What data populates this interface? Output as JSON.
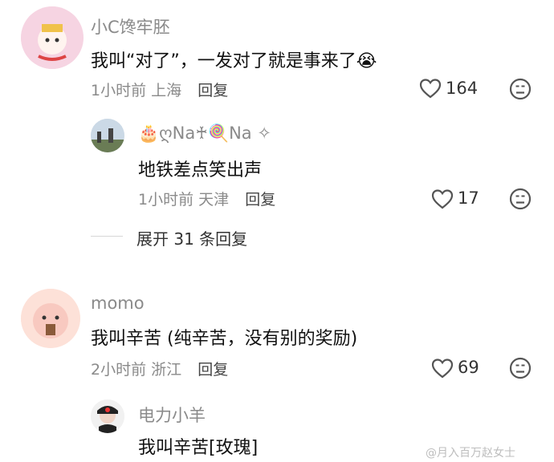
{
  "comments": [
    {
      "user": "小C馋牢胚",
      "text": "我叫“对了”，一发对了就是事来了",
      "emoji": "😭",
      "time": "1小时前",
      "location": "上海",
      "reply_label": "回复",
      "likes": "164"
    },
    {
      "user": "🎂ღNa♰🍭Na ✧",
      "text": "地铁差点笑出声",
      "time": "1小时前",
      "location": "天津",
      "reply_label": "回复",
      "likes": "17"
    },
    {
      "user": "momo",
      "text": "我叫辛苦 (纯辛苦，没有别的奖励)",
      "time": "2小时前",
      "location": "浙江",
      "reply_label": "回复",
      "likes": "69"
    },
    {
      "user": "电力小羊",
      "text": "我叫辛苦[玫瑰]"
    }
  ],
  "expand_replies": "展开 31 条回复",
  "watermark": "@月入百万赵女士",
  "colors": {
    "meta": "#8a8a8a",
    "text": "#111111",
    "icon": "#555555"
  }
}
